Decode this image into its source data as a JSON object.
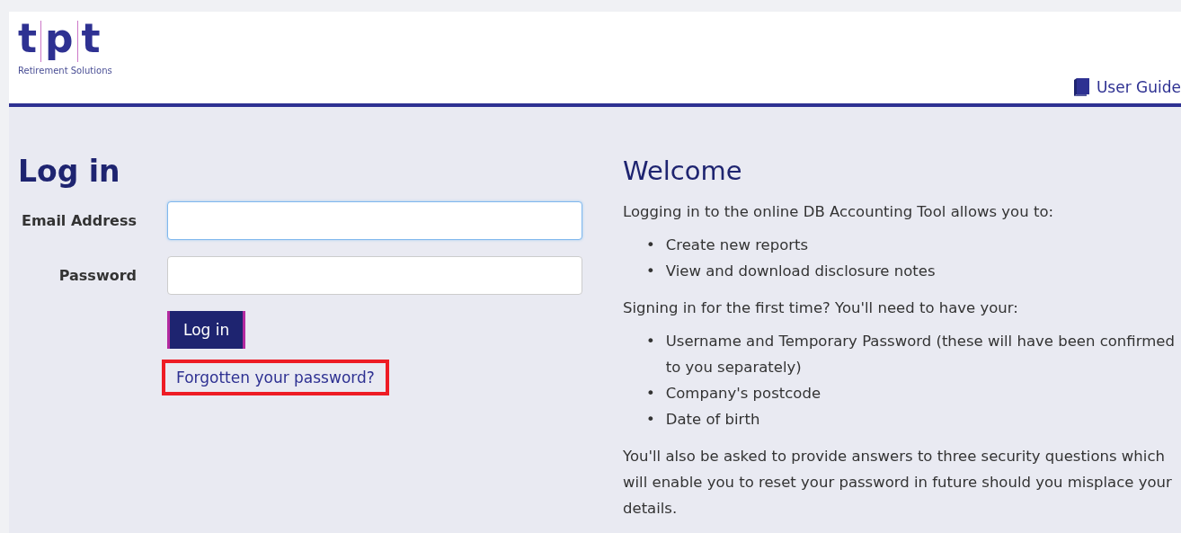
{
  "header": {
    "logo": {
      "letters": [
        "t",
        "p",
        "t"
      ],
      "tagline": "Retirement Solutions"
    },
    "user_guide": "User Guide"
  },
  "login": {
    "title": "Log in",
    "fields": [
      {
        "label": "Email Address",
        "focused": true
      },
      {
        "label": "Password",
        "focused": false
      }
    ],
    "button": "Log in",
    "forgot_link": {
      "text": "Forgotten your password?",
      "highlighted": true
    }
  },
  "welcome": {
    "title": "Welcome",
    "intro": "Logging in to the online DB Accounting Tool allows you to:",
    "bullet": "•",
    "features": [
      "Create new reports",
      "View and download disclosure notes"
    ],
    "first_time": "Signing in for the first time? You'll need to have your:",
    "requirements": [
      "Username and Temporary Password (these will have been confirmed to you separately)",
      "Company's postcode",
      "Date of birth"
    ],
    "security": "You'll also be asked to provide answers to three security questions which will enable you to reset your password in future should you misplace your details."
  }
}
